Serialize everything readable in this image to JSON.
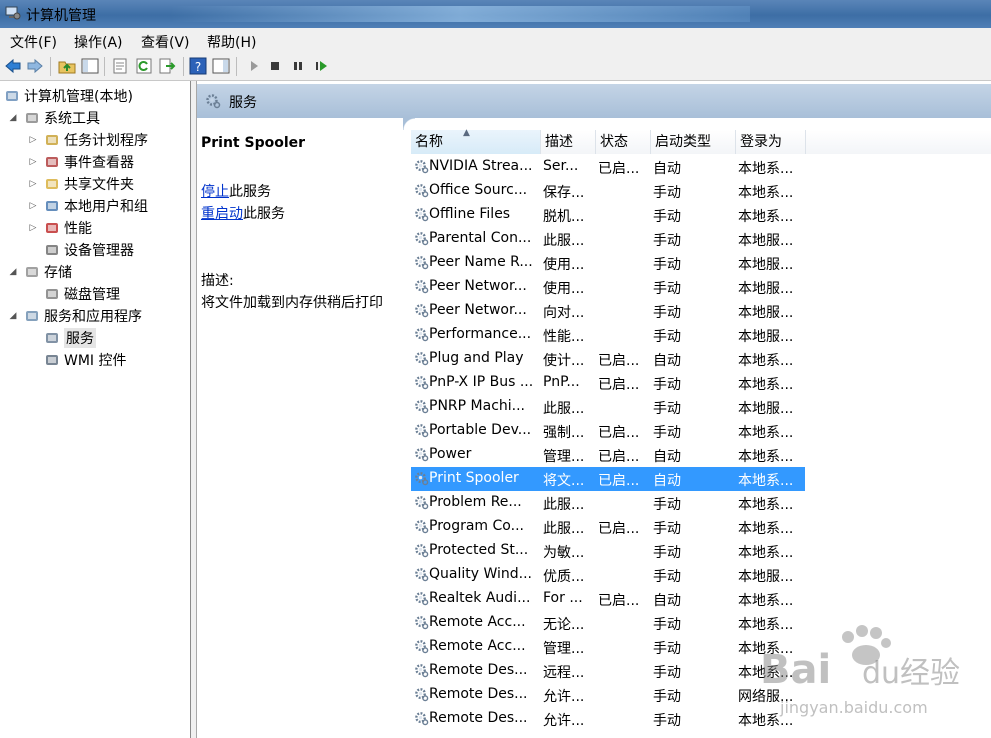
{
  "window": {
    "title": "计算机管理"
  },
  "menu": [
    "文件(F)",
    "操作(A)",
    "查看(V)",
    "帮助(H)"
  ],
  "toolbar": {
    "buttons": [
      "back-icon",
      "forward-icon",
      "up-folder-icon",
      "show-hide-tree-icon",
      "properties-icon",
      "refresh-icon",
      "export-list-icon",
      "help-icon",
      "show-hide-action-pane-icon",
      "start-icon",
      "stop-icon",
      "pause-icon",
      "restart-icon"
    ]
  },
  "tree": [
    {
      "label": "计算机管理(本地)",
      "level": 0,
      "expander": "",
      "icon": "computer-management-icon"
    },
    {
      "label": "系统工具",
      "level": 1,
      "expander": "◢",
      "icon": "tools-icon"
    },
    {
      "label": "任务计划程序",
      "level": 2,
      "expander": "▷",
      "icon": "clock-icon"
    },
    {
      "label": "事件查看器",
      "level": 2,
      "expander": "▷",
      "icon": "event-viewer-icon"
    },
    {
      "label": "共享文件夹",
      "level": 2,
      "expander": "▷",
      "icon": "shared-folder-icon"
    },
    {
      "label": "本地用户和组",
      "level": 2,
      "expander": "▷",
      "icon": "users-icon"
    },
    {
      "label": "性能",
      "level": 2,
      "expander": "▷",
      "icon": "performance-icon"
    },
    {
      "label": "设备管理器",
      "level": 2,
      "expander": "",
      "icon": "device-manager-icon"
    },
    {
      "label": "存储",
      "level": 1,
      "expander": "◢",
      "icon": "storage-icon"
    },
    {
      "label": "磁盘管理",
      "level": 2,
      "expander": "",
      "icon": "disk-icon"
    },
    {
      "label": "服务和应用程序",
      "level": 1,
      "expander": "◢",
      "icon": "services-apps-icon"
    },
    {
      "label": "服务",
      "level": 2,
      "expander": "",
      "icon": "services-gear-icon",
      "selected": true
    },
    {
      "label": "WMI 控件",
      "level": 2,
      "expander": "",
      "icon": "wmi-icon"
    }
  ],
  "header": {
    "title": "服务"
  },
  "desc_panel": {
    "service_name": "Print Spooler",
    "stop_link": "停止",
    "stop_suffix": "此服务",
    "restart_link": "重启动",
    "restart_suffix": "此服务",
    "desc_label": "描述:",
    "desc_text": "将文件加载到内存供稍后打印"
  },
  "columns": [
    "名称",
    "描述",
    "状态",
    "启动类型",
    "登录为"
  ],
  "services": [
    {
      "name": "NVIDIA Strea...",
      "desc": "Ser...",
      "status": "已启...",
      "startup": "自动",
      "logon": "本地系..."
    },
    {
      "name": "Office Sourc...",
      "desc": "保存...",
      "status": "",
      "startup": "手动",
      "logon": "本地系..."
    },
    {
      "name": "Offline Files",
      "desc": "脱机...",
      "status": "",
      "startup": "手动",
      "logon": "本地系..."
    },
    {
      "name": "Parental Con...",
      "desc": "此服...",
      "status": "",
      "startup": "手动",
      "logon": "本地服..."
    },
    {
      "name": "Peer Name R...",
      "desc": "使用...",
      "status": "",
      "startup": "手动",
      "logon": "本地服..."
    },
    {
      "name": "Peer Networ...",
      "desc": "使用...",
      "status": "",
      "startup": "手动",
      "logon": "本地服..."
    },
    {
      "name": "Peer Networ...",
      "desc": "向对...",
      "status": "",
      "startup": "手动",
      "logon": "本地服..."
    },
    {
      "name": "Performance...",
      "desc": "性能...",
      "status": "",
      "startup": "手动",
      "logon": "本地服..."
    },
    {
      "name": "Plug and Play",
      "desc": "使计...",
      "status": "已启...",
      "startup": "自动",
      "logon": "本地系..."
    },
    {
      "name": "PnP-X IP Bus ...",
      "desc": "PnP...",
      "status": "已启...",
      "startup": "手动",
      "logon": "本地系..."
    },
    {
      "name": "PNRP Machi...",
      "desc": "此服...",
      "status": "",
      "startup": "手动",
      "logon": "本地服..."
    },
    {
      "name": "Portable Dev...",
      "desc": "强制...",
      "status": "已启...",
      "startup": "手动",
      "logon": "本地系..."
    },
    {
      "name": "Power",
      "desc": "管理...",
      "status": "已启...",
      "startup": "自动",
      "logon": "本地系..."
    },
    {
      "name": "Print Spooler",
      "desc": "将文...",
      "status": "已启...",
      "startup": "自动",
      "logon": "本地系...",
      "selected": true
    },
    {
      "name": "Problem Re...",
      "desc": "此服...",
      "status": "",
      "startup": "手动",
      "logon": "本地系..."
    },
    {
      "name": "Program Co...",
      "desc": "此服...",
      "status": "已启...",
      "startup": "手动",
      "logon": "本地系..."
    },
    {
      "name": "Protected St...",
      "desc": "为敏...",
      "status": "",
      "startup": "手动",
      "logon": "本地系..."
    },
    {
      "name": "Quality Wind...",
      "desc": "优质...",
      "status": "",
      "startup": "手动",
      "logon": "本地服..."
    },
    {
      "name": "Realtek Audi...",
      "desc": "For ...",
      "status": "已启...",
      "startup": "自动",
      "logon": "本地系..."
    },
    {
      "name": "Remote Acc...",
      "desc": "无论...",
      "status": "",
      "startup": "手动",
      "logon": "本地系..."
    },
    {
      "name": "Remote Acc...",
      "desc": "管理...",
      "status": "",
      "startup": "手动",
      "logon": "本地系..."
    },
    {
      "name": "Remote Des...",
      "desc": "远程...",
      "status": "",
      "startup": "手动",
      "logon": "本地系..."
    },
    {
      "name": "Remote Des...",
      "desc": "允许...",
      "status": "",
      "startup": "手动",
      "logon": "网络服..."
    },
    {
      "name": "Remote Des...",
      "desc": "允许...",
      "status": "",
      "startup": "手动",
      "logon": "本地系..."
    }
  ],
  "watermark": {
    "text": "Baidu经验",
    "url_text": "jingyan.baidu.com"
  },
  "colors": {
    "selection": "#3399ff",
    "header_band": "#b6c9de",
    "link": "#0033cc"
  }
}
